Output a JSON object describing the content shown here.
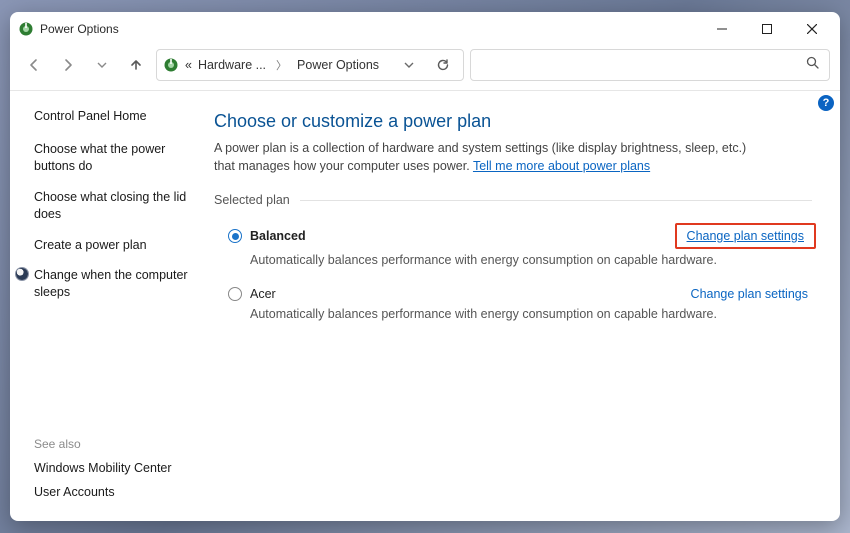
{
  "title": "Power Options",
  "breadcrumb": {
    "prefix": "«",
    "part1": "Hardware ...",
    "part2": "Power Options"
  },
  "help_badge": "?",
  "sidebar": {
    "home": "Control Panel Home",
    "links": [
      "Choose what the power buttons do",
      "Choose what closing the lid does",
      "Create a power plan",
      "Change when the computer sleeps"
    ],
    "see_also_heading": "See also",
    "see_also": [
      "Windows Mobility Center",
      "User Accounts"
    ]
  },
  "main": {
    "heading": "Choose or customize a power plan",
    "intro_a": "A power plan is a collection of hardware and system settings (like display brightness, sleep, etc.) that manages how your computer uses power. ",
    "intro_link": "Tell me more about power plans",
    "section_label": "Selected plan",
    "plans": [
      {
        "name": "Balanced",
        "desc": "Automatically balances performance with energy consumption on capable hardware.",
        "change": "Change plan settings"
      },
      {
        "name": "Acer",
        "desc": "Automatically balances performance with energy consumption on capable hardware.",
        "change": "Change plan settings"
      }
    ]
  }
}
